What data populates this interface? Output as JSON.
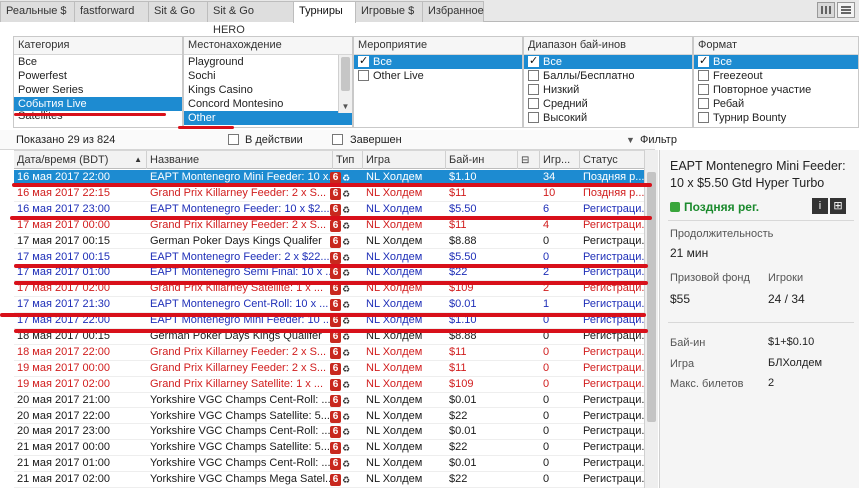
{
  "tabs": [
    {
      "label": "Реальные $"
    },
    {
      "label": "fastforward"
    },
    {
      "label": "Sit & Go"
    },
    {
      "label": "Sit & Go HERO"
    },
    {
      "label": "Турниры"
    },
    {
      "label": "Игровые $"
    },
    {
      "label": "Избранное"
    }
  ],
  "filters": {
    "category": {
      "header": "Категория",
      "items": [
        "Все",
        "Powerfest",
        "Power Series",
        "События Live",
        "Satellites"
      ],
      "selected": "События Live"
    },
    "location": {
      "header": "Местонахождение",
      "items": [
        "Playground",
        "Sochi",
        "Kings Casino",
        "Concord Montesino",
        "Other"
      ],
      "selected": "Other"
    },
    "event": {
      "header": "Мероприятие",
      "items": [
        {
          "label": "Все",
          "checked": true,
          "selected": true
        },
        {
          "label": "Other Live",
          "checked": false,
          "selected": false
        }
      ]
    },
    "buyin": {
      "header": "Диапазон бай-инов",
      "items": [
        {
          "label": "Все",
          "checked": true,
          "selected": true
        },
        {
          "label": "Баллы/Бесплатно",
          "checked": false,
          "selected": false
        },
        {
          "label": "Низкий",
          "checked": false,
          "selected": false
        },
        {
          "label": "Средний",
          "checked": false,
          "selected": false
        },
        {
          "label": "Высокий",
          "checked": false,
          "selected": false
        }
      ]
    },
    "format": {
      "header": "Формат",
      "items": [
        {
          "label": "Все",
          "checked": true,
          "selected": true
        },
        {
          "label": "Freezeout",
          "checked": false,
          "selected": false
        },
        {
          "label": "Повторное участие",
          "checked": false,
          "selected": false
        },
        {
          "label": "Ребай",
          "checked": false,
          "selected": false
        },
        {
          "label": "Турнир Bounty",
          "checked": false,
          "selected": false
        }
      ]
    }
  },
  "statusbar": {
    "shown": "Показано 29 из 824",
    "in_action": "В действии",
    "finished": "Завершен",
    "filter": "Фильтр"
  },
  "columns": {
    "datetime": "Дата/время (BDT)",
    "name": "Название",
    "type": "Тип",
    "game": "Игра",
    "buyin": "Бай-ин",
    "players": "Игр...",
    "status": "Статус"
  },
  "rows": [
    {
      "date": "16 мая 2017 22:00",
      "name": "EAPT Montenegro Mini Feeder: 10 x...",
      "game": "NL Холдем",
      "buyin": "$1.10",
      "players": "34",
      "status": "Поздняя р...",
      "style": "sel"
    },
    {
      "date": "16 мая 2017 22:15",
      "name": "Grand Prix Killarney Feeder: 2 x S...",
      "game": "NL Холдем",
      "buyin": "$11",
      "players": "10",
      "status": "Поздняя р...",
      "style": "red"
    },
    {
      "date": "16 мая 2017 23:00",
      "name": "EAPT Montenegro Feeder: 10 x $2...",
      "game": "NL Холдем",
      "buyin": "$5.50",
      "players": "6",
      "status": "Регистраци...",
      "style": "blue"
    },
    {
      "date": "17 мая 2017 00:00",
      "name": "Grand Prix Killarney Feeder: 2 x S...",
      "game": "NL Холдем",
      "buyin": "$11",
      "players": "4",
      "status": "Регистраци...",
      "style": "red"
    },
    {
      "date": "17 мая 2017 00:15",
      "name": "German Poker Days Kings Qualifer",
      "game": "NL Холдем",
      "buyin": "$8.88",
      "players": "0",
      "status": "Регистраци...",
      "style": "black"
    },
    {
      "date": "17 мая 2017 00:15",
      "name": "EAPT Montenegro Feeder: 2 x $22...",
      "game": "NL Холдем",
      "buyin": "$5.50",
      "players": "0",
      "status": "Регистраци...",
      "style": "blue"
    },
    {
      "date": "17 мая 2017 01:00",
      "name": "EAPT Montenegro Semi Final: 10 x ...",
      "game": "NL Холдем",
      "buyin": "$22",
      "players": "2",
      "status": "Регистраци...",
      "style": "blue"
    },
    {
      "date": "17 мая 2017 02:00",
      "name": "Grand Prix Killarney Satellite: 1 x ...",
      "game": "NL Холдем",
      "buyin": "$109",
      "players": "2",
      "status": "Регистраци...",
      "style": "red"
    },
    {
      "date": "17 мая 2017 21:30",
      "name": "EAPT Montenegro Cent-Roll: 10 x ...",
      "game": "NL Холдем",
      "buyin": "$0.01",
      "players": "1",
      "status": "Регистраци...",
      "style": "blue"
    },
    {
      "date": "17 мая 2017 22:00",
      "name": "EAPT Montenegro Mini Feeder: 10 ...",
      "game": "NL Холдем",
      "buyin": "$1.10",
      "players": "0",
      "status": "Регистраци...",
      "style": "blue"
    },
    {
      "date": "18 мая 2017 00:15",
      "name": "German Poker Days Kings Qualifer",
      "game": "NL Холдем",
      "buyin": "$8.88",
      "players": "0",
      "status": "Регистраци...",
      "style": "black"
    },
    {
      "date": "18 мая 2017 22:00",
      "name": "Grand Prix Killarney Feeder: 2 x S...",
      "game": "NL Холдем",
      "buyin": "$11",
      "players": "0",
      "status": "Регистраци...",
      "style": "red"
    },
    {
      "date": "19 мая 2017 00:00",
      "name": "Grand Prix Killarney Feeder: 2 x S...",
      "game": "NL Холдем",
      "buyin": "$11",
      "players": "0",
      "status": "Регистраци...",
      "style": "red"
    },
    {
      "date": "19 мая 2017 02:00",
      "name": "Grand Prix Killarney Satellite: 1 x ...",
      "game": "NL Холдем",
      "buyin": "$109",
      "players": "0",
      "status": "Регистраци...",
      "style": "red"
    },
    {
      "date": "20 мая 2017 21:00",
      "name": "Yorkshire VGC Champs Cent-Roll: ...",
      "game": "NL Холдем",
      "buyin": "$0.01",
      "players": "0",
      "status": "Регистраци...",
      "style": "black"
    },
    {
      "date": "20 мая 2017 22:00",
      "name": "Yorkshire VGC Champs Satellite: 5...",
      "game": "NL Холдем",
      "buyin": "$22",
      "players": "0",
      "status": "Регистраци...",
      "style": "black"
    },
    {
      "date": "20 мая 2017 23:00",
      "name": "Yorkshire VGC Champs Cent-Roll: ...",
      "game": "NL Холдем",
      "buyin": "$0.01",
      "players": "0",
      "status": "Регистраци...",
      "style": "black"
    },
    {
      "date": "21 мая 2017 00:00",
      "name": "Yorkshire VGC Champs Satellite: 5...",
      "game": "NL Холдем",
      "buyin": "$22",
      "players": "0",
      "status": "Регистраци...",
      "style": "black"
    },
    {
      "date": "21 мая 2017 01:00",
      "name": "Yorkshire VGC Champs Cent-Roll: ...",
      "game": "NL Холдем",
      "buyin": "$0.01",
      "players": "0",
      "status": "Регистраци...",
      "style": "black"
    },
    {
      "date": "21 мая 2017 02:00",
      "name": "Yorkshire VGC Champs Mega Satel...",
      "game": "NL Холдем",
      "buyin": "$22",
      "players": "0",
      "status": "Регистраци...",
      "style": "black"
    }
  ],
  "badge_label": "6",
  "detail": {
    "title": "EAPT Montenegro Mini Feeder: 10 x $5.50 Gtd Hyper Turbo",
    "status": "Поздняя рег.",
    "info_icon": "i",
    "grid_icon": "⊞",
    "duration_label": "Продолжительность",
    "duration_value": "21 мин",
    "prize_label": "Призовой фонд",
    "prize_value": "$55",
    "players_label": "Игроки",
    "players_value": "24 / 34",
    "buyin_label": "Бай-ин",
    "buyin_value": "$1+$0.10",
    "game_label": "Игра",
    "game_value": "БЛХолдем",
    "max_label": "Макс. билетов",
    "max_value": "2"
  },
  "colors": {
    "selection": "#1d8bd1",
    "red_rows": "#d11d1d",
    "blue_rows": "#1f2fb8",
    "annotation": "#d8101a",
    "late_reg": "#1b8a2d"
  }
}
